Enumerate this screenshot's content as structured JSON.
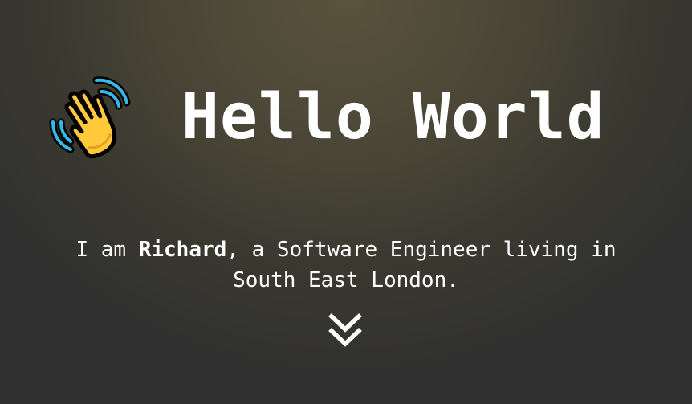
{
  "hero": {
    "title": "Hello World",
    "wave_icon": "waving-hand-emoji",
    "intro_prefix": "I am ",
    "intro_name": "Richard",
    "intro_line1_rest": ", a Software Engineer living in",
    "intro_line2": "South East London.",
    "scroll_icon": "double-chevron-down-icon"
  },
  "colors": {
    "text": "#ffffff",
    "background_center": "#5a523c",
    "background_edge": "#303030",
    "hand": "#ffc93a",
    "motion_lines": "#35b9e8"
  }
}
